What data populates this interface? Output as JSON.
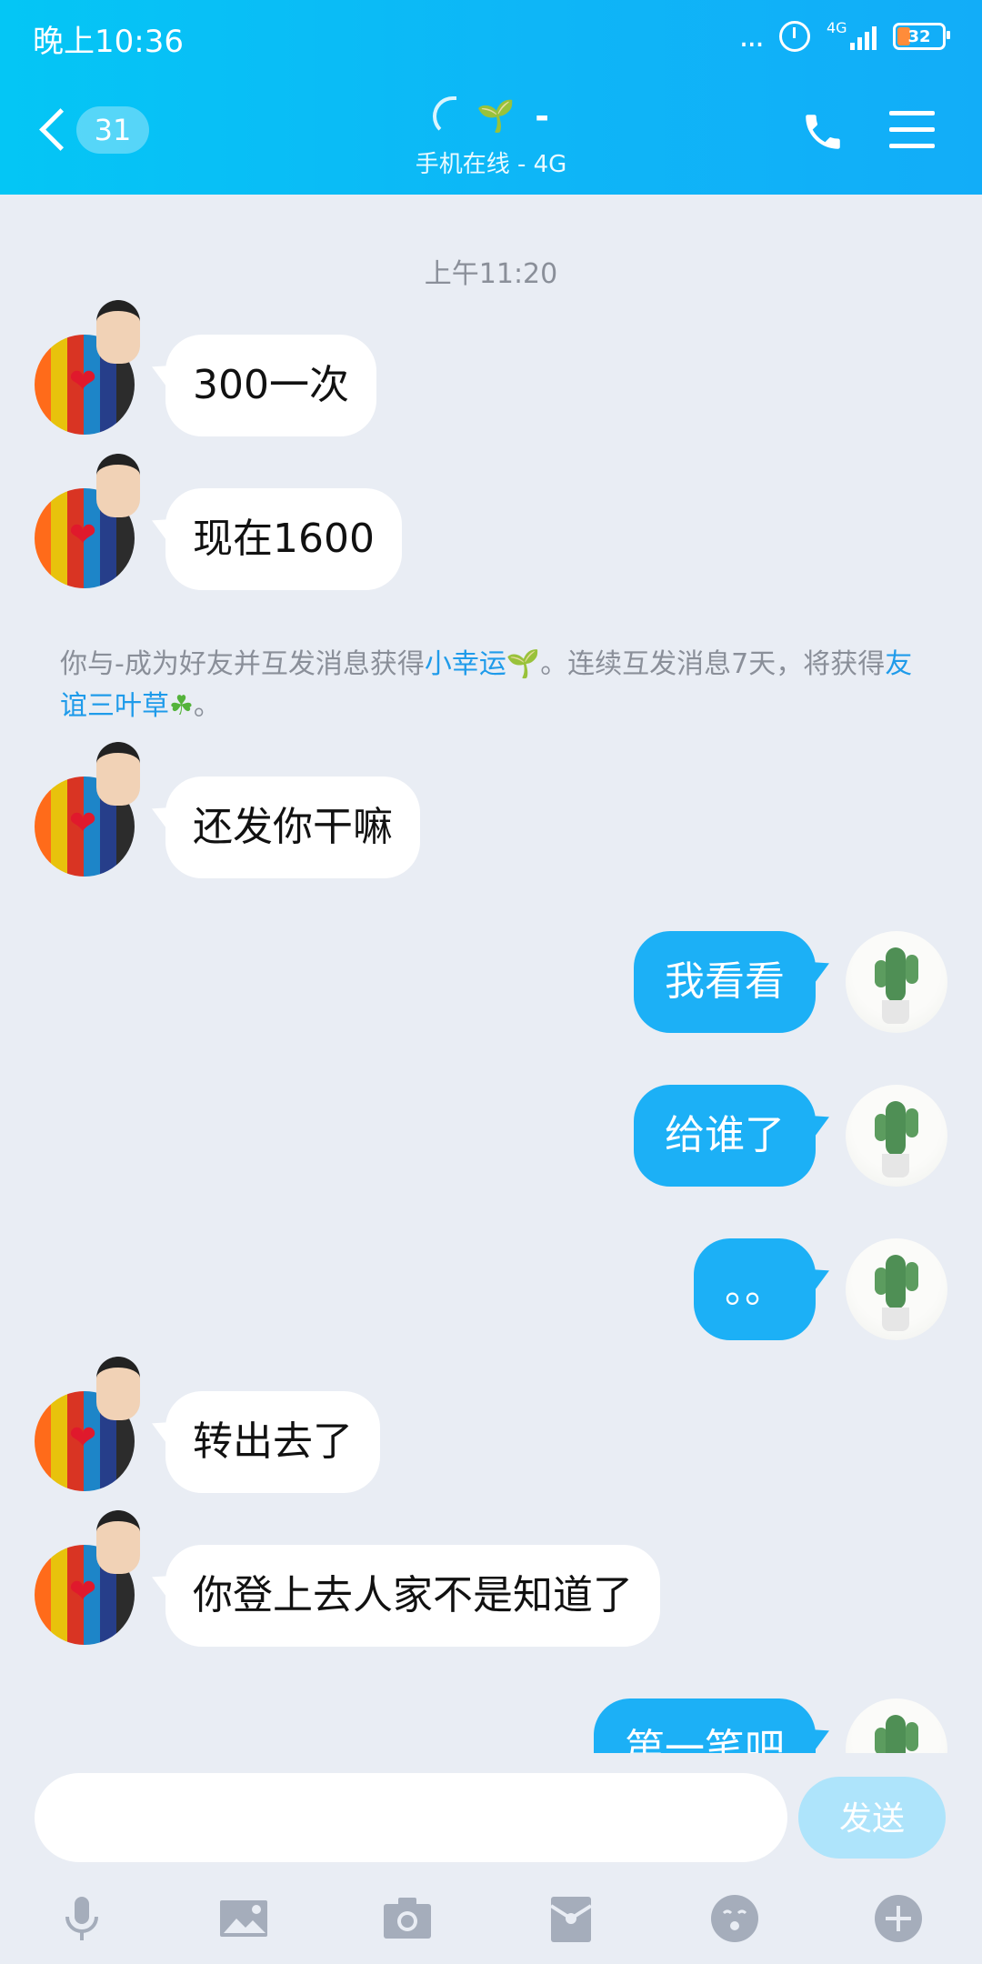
{
  "status_bar": {
    "time": "晚上10:36",
    "dots": "...",
    "network": "4G",
    "battery": "32"
  },
  "header": {
    "unread_count": "31",
    "title": "-",
    "subtitle": "手机在线 - 4G",
    "accent": "#12b4f6"
  },
  "chat": {
    "time_separator": "上午11:20",
    "messages": [
      {
        "side": "in",
        "text": "300一次"
      },
      {
        "side": "in",
        "text": "现在1600"
      },
      {
        "side": "in",
        "text": "还发你干嘛"
      },
      {
        "side": "out",
        "text": "我看看"
      },
      {
        "side": "out",
        "text": "给谁了"
      },
      {
        "side": "out",
        "text": "。。"
      },
      {
        "side": "in",
        "text": "转出去了"
      },
      {
        "side": "in",
        "text": "你登上去人家不是知道了"
      },
      {
        "side": "out",
        "text": "第一笔吧"
      }
    ],
    "system_notice": {
      "part1": "你与-成为好友并互发消息获得",
      "link1": "小幸运",
      "part2": "。连续互发消息7天，将获得",
      "link2": "友谊三叶草",
      "part3": "。"
    }
  },
  "input_bar": {
    "value": "",
    "send_label": "发送"
  },
  "toolbar": {
    "items": [
      "mic-icon",
      "image-icon",
      "camera-icon",
      "red-packet-icon",
      "emoji-icon",
      "plus-icon"
    ]
  }
}
